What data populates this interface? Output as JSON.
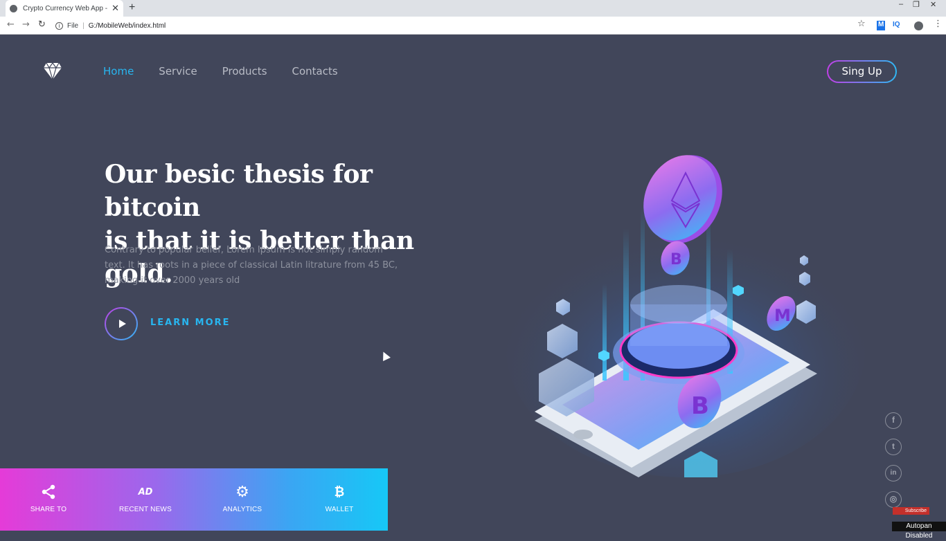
{
  "browser": {
    "tab_title": "Crypto Currency Web App - Easy",
    "tab_close": "✕",
    "new_tab": "+",
    "omnibox_scheme": "File",
    "omnibox_separator": "|",
    "url": "G:/MobileWeb/index.html",
    "info_glyph": "i",
    "back_glyph": "←",
    "forward_glyph": "→",
    "reload_glyph": "↻",
    "star_glyph": "☆",
    "menu_glyph": "⋮",
    "ext_m": "M",
    "ext_iq": "IQ",
    "minimize": "–",
    "restore": "❐",
    "close": "✕"
  },
  "nav": {
    "items": [
      "Home",
      "Service",
      "Products",
      "Contacts"
    ],
    "active": "Home",
    "signup_label": "Sing Up"
  },
  "hero": {
    "headline_line1": "Our besic thesis for bitcoin",
    "headline_line2": "is that it is better than gold.",
    "body_line1": "Contrary to popular belief, Lorem Ipsum is not simply random",
    "body_line2": "text. It has roots in a piece of classical Latin litrature from 45 BC,",
    "body_line3": "making it over 2000 years old",
    "cta_label": "LEARN MORE"
  },
  "social": {
    "facebook": "f",
    "twitter": "t",
    "linkedin": "in",
    "instagram": "◎"
  },
  "bottom_bar": {
    "items": [
      {
        "label": "SHARE TO",
        "icon": "share-icon"
      },
      {
        "label": "RECENT NEWS",
        "icon": "ad-icon",
        "glyph": "AD"
      },
      {
        "label": "ANALYTICS",
        "icon": "gear-icon",
        "glyph": "⚙"
      },
      {
        "label": "WALLET",
        "icon": "bitcoin-icon",
        "glyph": "₿"
      }
    ]
  },
  "overlays": {
    "subscribe": "Subscribe",
    "autopan": "Autopan Disabled"
  },
  "colors": {
    "background": "#41465a",
    "accent_blue": "#28b6f0",
    "accent_pink": "#c13fe6"
  }
}
